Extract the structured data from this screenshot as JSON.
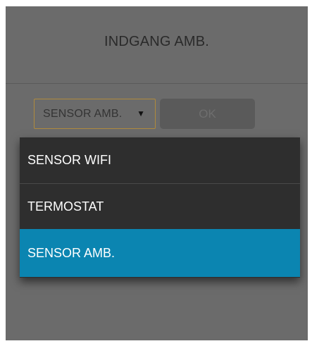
{
  "dialog": {
    "title": "INDGANG AMB."
  },
  "select": {
    "value": "SENSOR AMB.",
    "arrow_icon": "triangle-down-icon"
  },
  "ok_button": {
    "label": "OK"
  },
  "dropdown": {
    "options": [
      {
        "label": "SENSOR WIFI",
        "selected": false
      },
      {
        "label": "TERMOSTAT",
        "selected": false
      },
      {
        "label": "SENSOR AMB.",
        "selected": true
      }
    ]
  },
  "colors": {
    "dialog_bg": "#6b6b6b",
    "dropdown_bg": "#2e2e2e",
    "selected_bg": "#0b85b1",
    "select_border": "#b08a3c"
  }
}
